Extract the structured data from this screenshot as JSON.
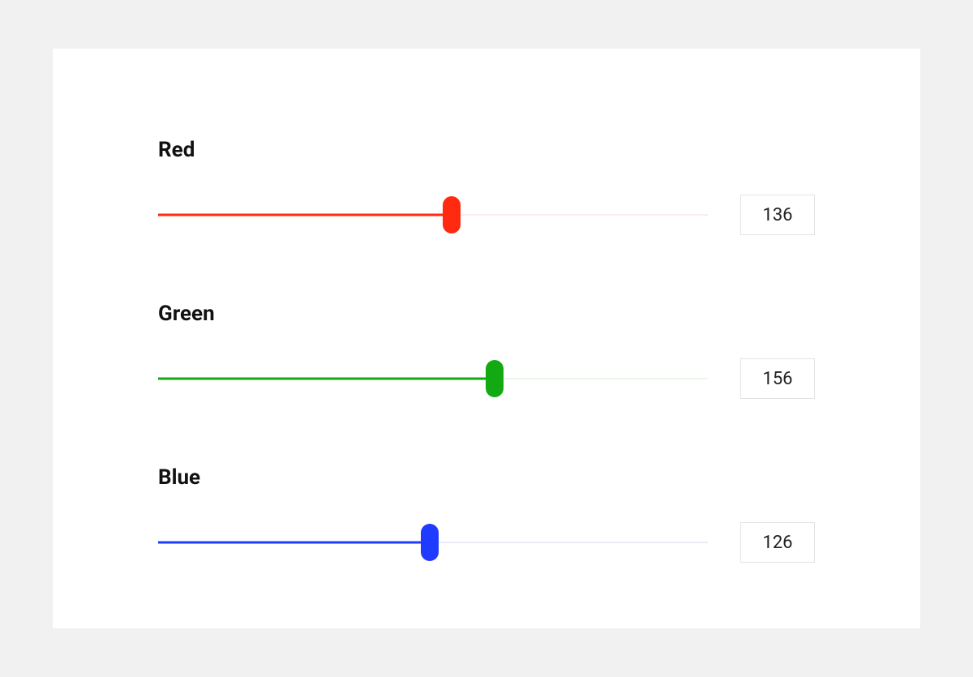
{
  "sliders": {
    "max": 255,
    "red": {
      "label": "Red",
      "value": 136,
      "color": "#ff2a0f",
      "track_bg": "#fdeceb"
    },
    "green": {
      "label": "Green",
      "value": 156,
      "color": "#13a910",
      "track_bg": "#e9f6e9"
    },
    "blue": {
      "label": "Blue",
      "value": 126,
      "color": "#1f3bff",
      "track_bg": "#ebecfa"
    }
  }
}
